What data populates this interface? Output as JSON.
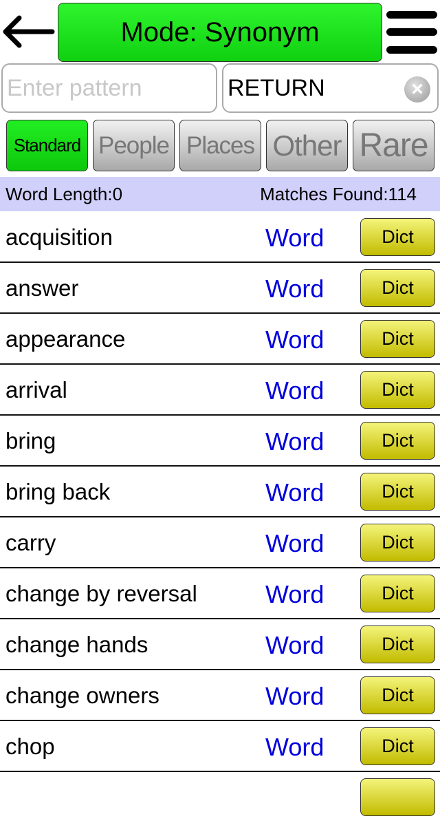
{
  "header": {
    "back_icon": "arrow-left-icon",
    "title": "Mode: Synonym",
    "menu_icon": "hamburger-menu-icon"
  },
  "search": {
    "pattern_placeholder": "Enter pattern",
    "pattern_value": "",
    "word_value": "RETURN",
    "clear_icon": "clear-x-icon"
  },
  "tabs": [
    {
      "label": "Standard",
      "active": true
    },
    {
      "label": "People"
    },
    {
      "label": "Places"
    },
    {
      "label": "Other"
    },
    {
      "label": "Rare"
    }
  ],
  "status": {
    "word_length": "Word Length:0",
    "matches": "Matches Found:114"
  },
  "colors": {
    "active": "#1ee61e",
    "status_bar": "#d0d0fa",
    "link": "#0000dd",
    "dict": "#dcd83a"
  },
  "results": [
    {
      "word": "acquisition",
      "link": "Word",
      "button": "Dict"
    },
    {
      "word": "answer",
      "link": "Word",
      "button": "Dict"
    },
    {
      "word": "appearance",
      "link": "Word",
      "button": "Dict"
    },
    {
      "word": "arrival",
      "link": "Word",
      "button": "Dict"
    },
    {
      "word": "bring",
      "link": "Word",
      "button": "Dict"
    },
    {
      "word": "bring back",
      "link": "Word",
      "button": "Dict"
    },
    {
      "word": "carry",
      "link": "Word",
      "button": "Dict"
    },
    {
      "word": "change by reversal",
      "link": "Word",
      "button": "Dict"
    },
    {
      "word": "change hands",
      "link": "Word",
      "button": "Dict"
    },
    {
      "word": "change owners",
      "link": "Word",
      "button": "Dict"
    },
    {
      "word": "chop",
      "link": "Word",
      "button": "Dict"
    }
  ]
}
